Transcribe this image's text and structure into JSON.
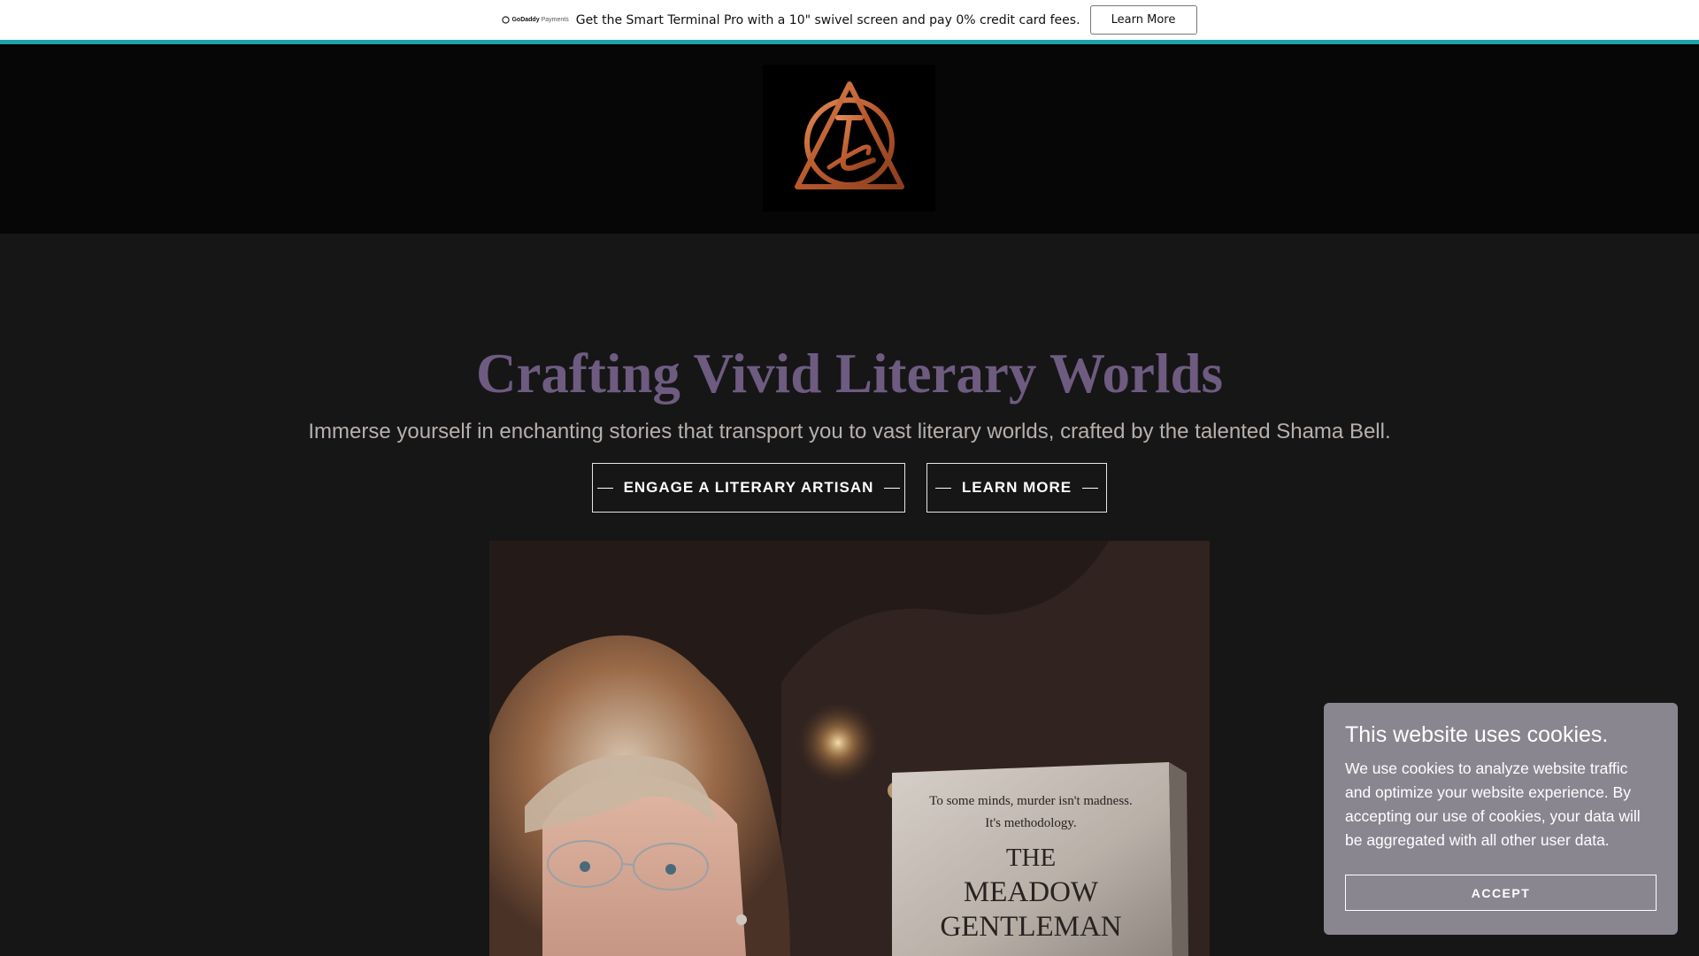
{
  "promo": {
    "brand": "GoDaddy",
    "brand_suffix": "Payments",
    "text": "Get the Smart Terminal Pro with a 10\" swivel screen and pay 0% credit card fees.",
    "button_label": "Learn More"
  },
  "hero": {
    "title": "Crafting Vivid Literary Worlds",
    "subtitle": "Immerse yourself in enchanting stories that transport you to vast literary worlds, crafted by the talented Shama Bell.",
    "primary_button": "ENGAGE A LITERARY ARTISAN",
    "secondary_button": "LEARN MORE"
  },
  "book": {
    "tagline_1": "To some minds, murder isn't madness.",
    "tagline_2": "It's methodology.",
    "title_1": "THE",
    "title_2": "MEADOW",
    "title_3": "GENTLEMAN"
  },
  "cookie": {
    "title": "This website uses cookies.",
    "text": "We use cookies to analyze website traffic and optimize your website experience. By accepting our use of cookies, your data will be aggregated with all other user data.",
    "accept_label": "ACCEPT"
  },
  "colors": {
    "accent": "#1fa3a8",
    "title": "#6e5b80",
    "logo": "#c26a3a"
  }
}
